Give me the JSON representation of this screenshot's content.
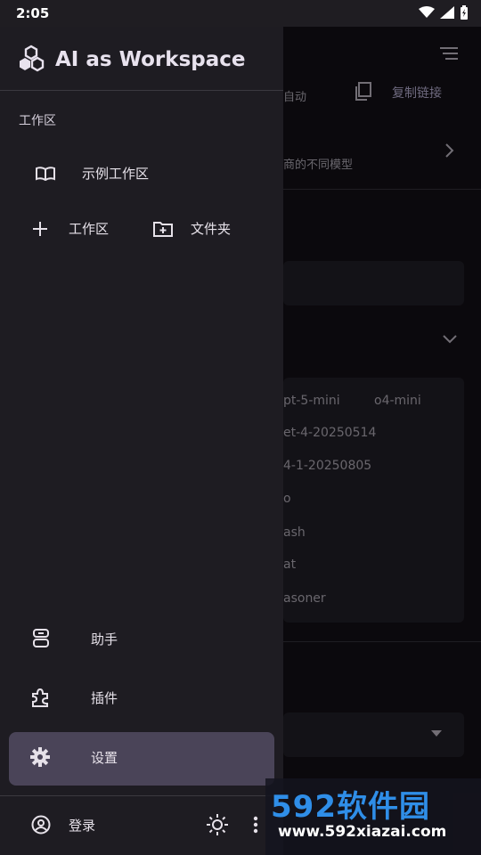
{
  "status": {
    "time": "2:05"
  },
  "background": {
    "auto_text": "自动",
    "copy_link": "复制链接",
    "models_hint": "商的不同模型",
    "chips": [
      "pt-5-mini",
      "o4-mini",
      "et-4-20250514",
      "4-1-20250805",
      "o",
      "ash",
      "at",
      "asoner"
    ]
  },
  "drawer": {
    "app_title": "AI as Workspace",
    "section_workspace": "工作区",
    "example_workspace": "示例工作区",
    "add_workspace": "工作区",
    "add_folder": "文件夹",
    "assistant": "助手",
    "plugins": "插件",
    "settings": "设置",
    "login": "登录"
  },
  "watermark": {
    "big": "592软件园",
    "small": "www.592xiazai.com"
  },
  "colors": {
    "selected": "#4a4458",
    "drawer_bg": "#1e1c22",
    "watermark_blue": "#2f8ee8"
  }
}
